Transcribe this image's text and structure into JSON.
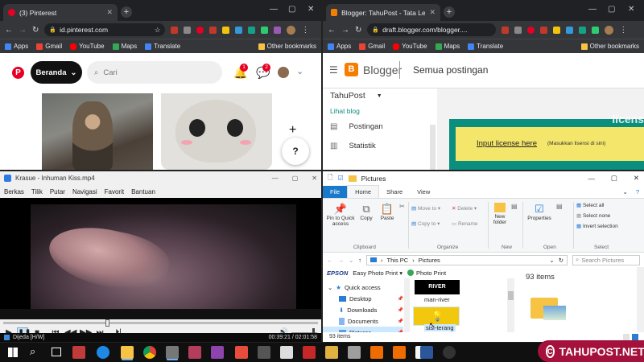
{
  "pinterest_window": {
    "tab_title": "(3) Pinterest",
    "url": "id.pinterest.com",
    "home_label": "Beranda",
    "search_placeholder": "Cari",
    "notif_count": "1",
    "msg_count": "2",
    "help_glyph": "?"
  },
  "blogger_window": {
    "tab_title": "Blogger: TahuPost - Tata Letak",
    "url": "draft.blogger.com/blogger....",
    "app_name": "Blogger",
    "page_title": "Semua postingan",
    "blog_name": "TahuPost",
    "view_blog": "Lihat blog",
    "nav": [
      "Postingan",
      "Statistik"
    ],
    "license_link": "Input license here",
    "license_hint": "(Masukkan lisensi di sini)",
    "license_bg_text": "licens"
  },
  "bookmarks": {
    "apps": "Apps",
    "gmail": "Gmail",
    "youtube": "YouTube",
    "maps": "Maps",
    "translate": "Translate",
    "other": "Other bookmarks"
  },
  "player": {
    "title": "Krasue - Inhuman Kiss.mp4",
    "menu": [
      "Berkas",
      "Tilik",
      "Putar",
      "Navigasi",
      "Favorit",
      "Bantuan"
    ],
    "status": "Dijeda [H/W]",
    "time": "00:39:21 / 02:01:58",
    "seek_fraction": 0.33,
    "volume_fraction": 0.85
  },
  "explorer": {
    "title": "Pictures",
    "tabs": [
      "File",
      "Home",
      "Share",
      "View"
    ],
    "ribbon": {
      "pin": "Pin to Quick access",
      "copy": "Copy",
      "paste": "Paste",
      "move_to": "Move to",
      "copy_to": "Copy to",
      "delete": "Delete",
      "rename": "Rename",
      "new_folder": "New folder",
      "properties": "Properties",
      "select_all": "Select all",
      "select_none": "Select none",
      "invert": "Invert selection",
      "groups": [
        "Clipboard",
        "Organize",
        "New",
        "Open",
        "Select"
      ]
    },
    "path": [
      "This PC",
      "Pictures"
    ],
    "search_placeholder": "Search Pictures",
    "epson": "EPSON",
    "epson_app": "Easy Photo Print",
    "photo_print": "Photo Print",
    "nav_items": [
      "Quick access",
      "Desktop",
      "Downloads",
      "Documents",
      "Pictures"
    ],
    "files": [
      "man-river",
      "sisi-terang"
    ],
    "river_caption": "RIVER",
    "count_label": "93 items",
    "status": "93 items"
  },
  "watermark": "TAHUPOST.NET",
  "colors": {
    "pinterest_red": "#e60023",
    "blogger_orange": "#f57d00",
    "explorer_blue": "#1979ca",
    "watermark_bg": "#a4113b",
    "license_yellow": "#f4e66a",
    "blogger_teal": "#0a8f7f"
  }
}
